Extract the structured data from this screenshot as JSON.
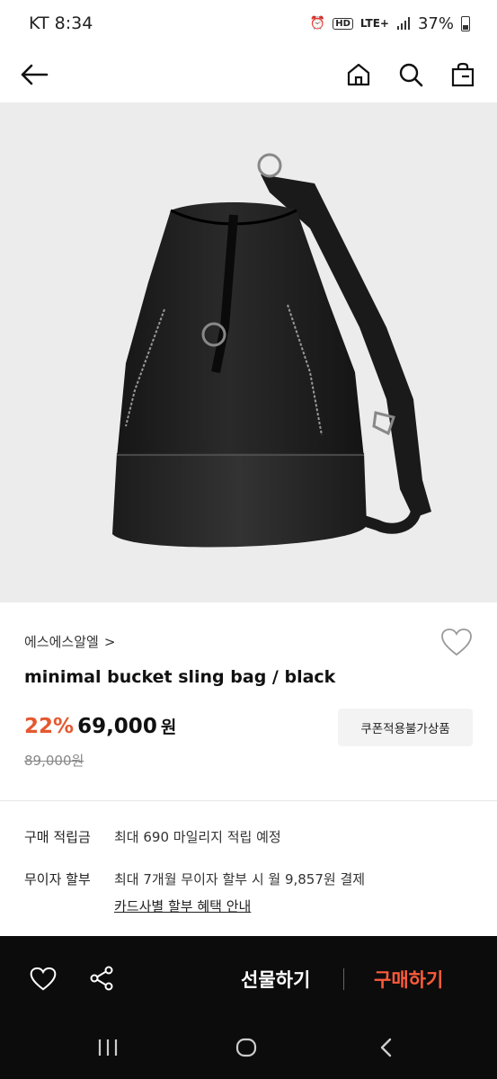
{
  "status_bar": {
    "carrier_time": "KT 8:34",
    "network": "LTE+",
    "battery": "37%"
  },
  "nav": {
    "back_icon": "arrow-left-icon",
    "home_icon": "home-icon",
    "search_icon": "search-icon",
    "bag_icon": "shopping-bag-icon"
  },
  "product": {
    "brand": "에스에스알엘",
    "brand_chevron": ">",
    "title": "minimal bucket sling bag / black",
    "discount": "22%",
    "price": "69,000",
    "price_unit": "원",
    "original_price": "89,000원",
    "coupon_badge": "쿠폰적용불가상품"
  },
  "details": {
    "points_label": "구매 적립금",
    "points_value": "최대 690 마일리지 적립 예정",
    "installment_label": "무이자 할부",
    "installment_value": "최대 7개월 무이자 할부 시 월 9,857원 결제",
    "installment_link": "카드사별 할부 혜택 안내"
  },
  "bottom_bar": {
    "gift_label": "선물하기",
    "buy_label": "구매하기"
  },
  "colors": {
    "accent": "#e5582f",
    "buy": "#ff5b3b",
    "bar_bg": "#0c0c0c"
  }
}
